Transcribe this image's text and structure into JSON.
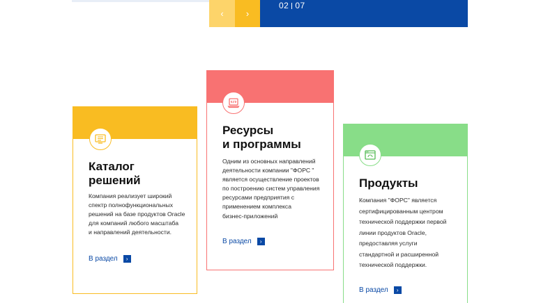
{
  "slider": {
    "prev_icon": "chevron-left-icon",
    "next_icon": "chevron-right-icon",
    "prev_glyph": "‹",
    "next_glyph": "›",
    "current": "02",
    "total": "07"
  },
  "cards": [
    {
      "title_line1": "Каталог",
      "title_line2": "решений",
      "icon": "catalog-document-icon",
      "desc_lines": [
        "Компания реализует широкий",
        "спектр полнофункциональных",
        "решений на базе продуктов Oracle",
        "для компаний любого масштаба",
        "и направлений деятельности."
      ],
      "link_label": "В раздел",
      "link_glyph": "›",
      "accent": "#f9bc22"
    },
    {
      "title_line1": "Ресурсы",
      "title_line2": "и программы",
      "icon": "code-laptop-icon",
      "desc_lines": [
        "Одним из основных направлений",
        "деятельности компании \"ФОРС \"",
        "является осуществление проектов",
        "по построению систем управления",
        "ресурсами предприятия с",
        "применением комплекса",
        "бизнес-приложений"
      ],
      "link_label": "В раздел",
      "link_glyph": "›",
      "accent": "#f87272"
    },
    {
      "title_line1": "Продукты",
      "icon": "browser-window-icon",
      "desc_lines": [
        "Компания \"ФОРС\" является",
        "сертифицированным центром",
        "технической поддержки первой",
        "линии продуктов Oracle,",
        "предоставляя услуги",
        "стандартной и расширенной",
        "технической поддержки."
      ],
      "link_label": "В раздел",
      "link_glyph": "›",
      "accent": "#88dd88"
    }
  ],
  "colors": {
    "brand_blue": "#0a49a5",
    "yellow_light": "#fdd46a",
    "yellow": "#f9bc22"
  }
}
